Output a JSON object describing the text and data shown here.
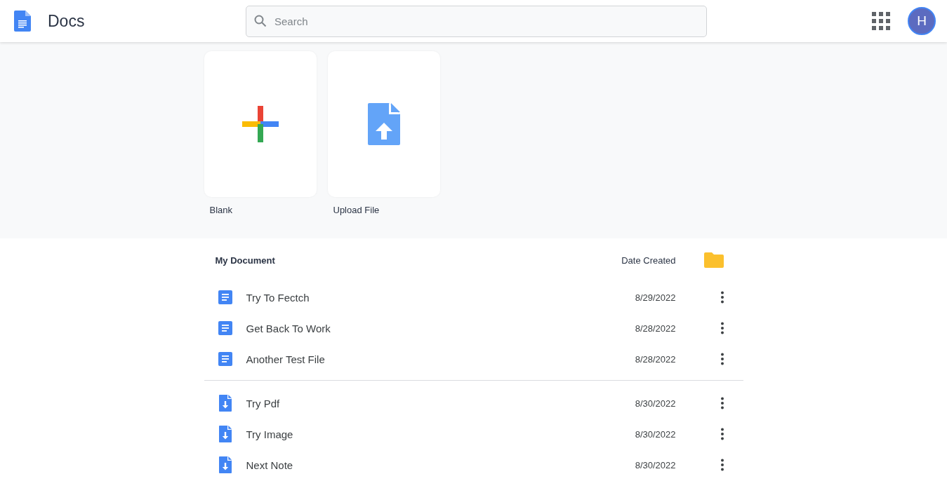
{
  "header": {
    "title": "Docs",
    "search": {
      "placeholder": "Search"
    },
    "avatar": "H"
  },
  "templates": [
    {
      "kind": "blank",
      "label": "Blank"
    },
    {
      "kind": "upload",
      "label": "Upload File"
    }
  ],
  "list": {
    "columns": [
      "My Document",
      "Date Created"
    ],
    "groups": [
      {
        "items": [
          {
            "kind": "doc",
            "name": "Try To Fectch",
            "date": "8/29/2022"
          },
          {
            "kind": "doc",
            "name": "Get Back To Work",
            "date": "8/28/2022"
          },
          {
            "kind": "doc",
            "name": "Another Test File",
            "date": "8/28/2022"
          }
        ]
      },
      {
        "items": [
          {
            "kind": "file",
            "name": "Try Pdf",
            "date": "8/30/2022"
          },
          {
            "kind": "file",
            "name": "Try Image",
            "date": "8/30/2022"
          },
          {
            "kind": "file",
            "name": "Next Note",
            "date": "8/30/2022"
          }
        ]
      }
    ]
  }
}
